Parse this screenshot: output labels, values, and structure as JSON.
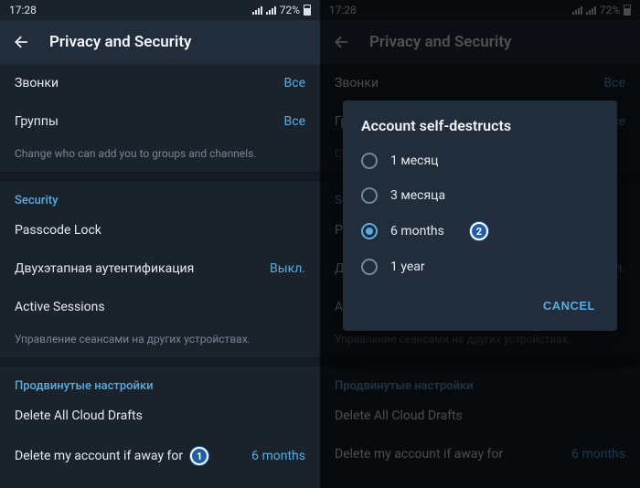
{
  "status": {
    "time": "17:28",
    "battery": "72%"
  },
  "header": {
    "title": "Privacy and Security"
  },
  "privacy": {
    "calls_label": "Звонки",
    "calls_value": "Все",
    "groups_label": "Группы",
    "groups_value": "Все",
    "groups_caption": "Change who can add you to groups and channels."
  },
  "security": {
    "section": "Security",
    "passcode": "Passcode Lock",
    "twostep_label": "Двухэтапная аутентификация",
    "twostep_value": "Выкл.",
    "sessions": "Active Sessions",
    "sessions_caption": "Управление сеансами на других устройствах."
  },
  "advanced": {
    "section": "Продвинутые настройки",
    "drafts": "Delete All Cloud Drafts",
    "delete_label": "Delete my account if away for",
    "delete_value": "6 months"
  },
  "dialog": {
    "title": "Account self-destructs",
    "options": [
      "1 месяц",
      "3 месяца",
      "6 months",
      "1 year"
    ],
    "selected": "6 months",
    "cancel": "CANCEL"
  },
  "markers": {
    "one": "1",
    "two": "2"
  }
}
